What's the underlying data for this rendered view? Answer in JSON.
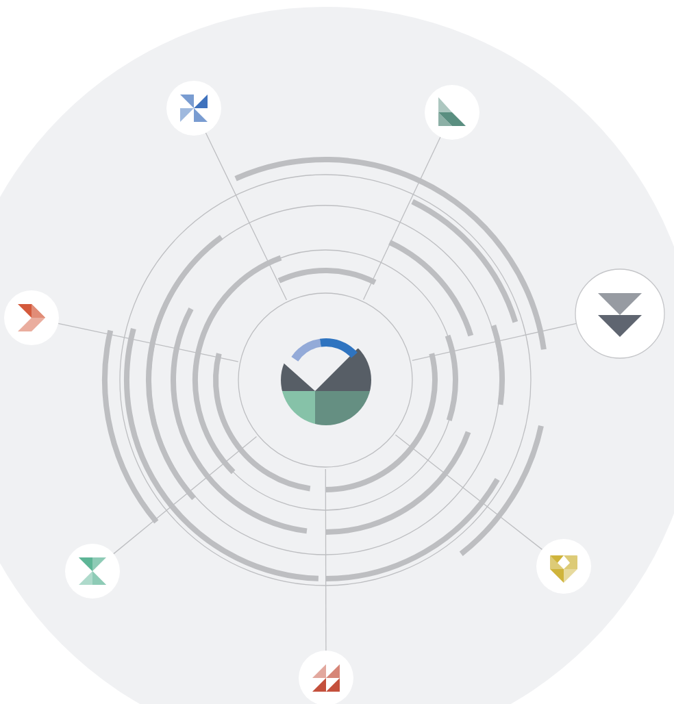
{
  "diagram": {
    "nodes": [
      {
        "kind": "pinwheel",
        "color": "#3f72bd",
        "selected": false
      },
      {
        "kind": "corner",
        "color": "#5a8e80",
        "selected": false
      },
      {
        "kind": "chevron-down",
        "color": "#5f6570",
        "selected": true
      },
      {
        "kind": "diamond",
        "color": "#cfb43c",
        "selected": false
      },
      {
        "kind": "zigzag",
        "color": "#c4503c",
        "selected": false
      },
      {
        "kind": "hourglass",
        "color": "#5db596",
        "selected": false
      },
      {
        "kind": "arrow",
        "color": "#d45a3c",
        "selected": false
      }
    ]
  }
}
